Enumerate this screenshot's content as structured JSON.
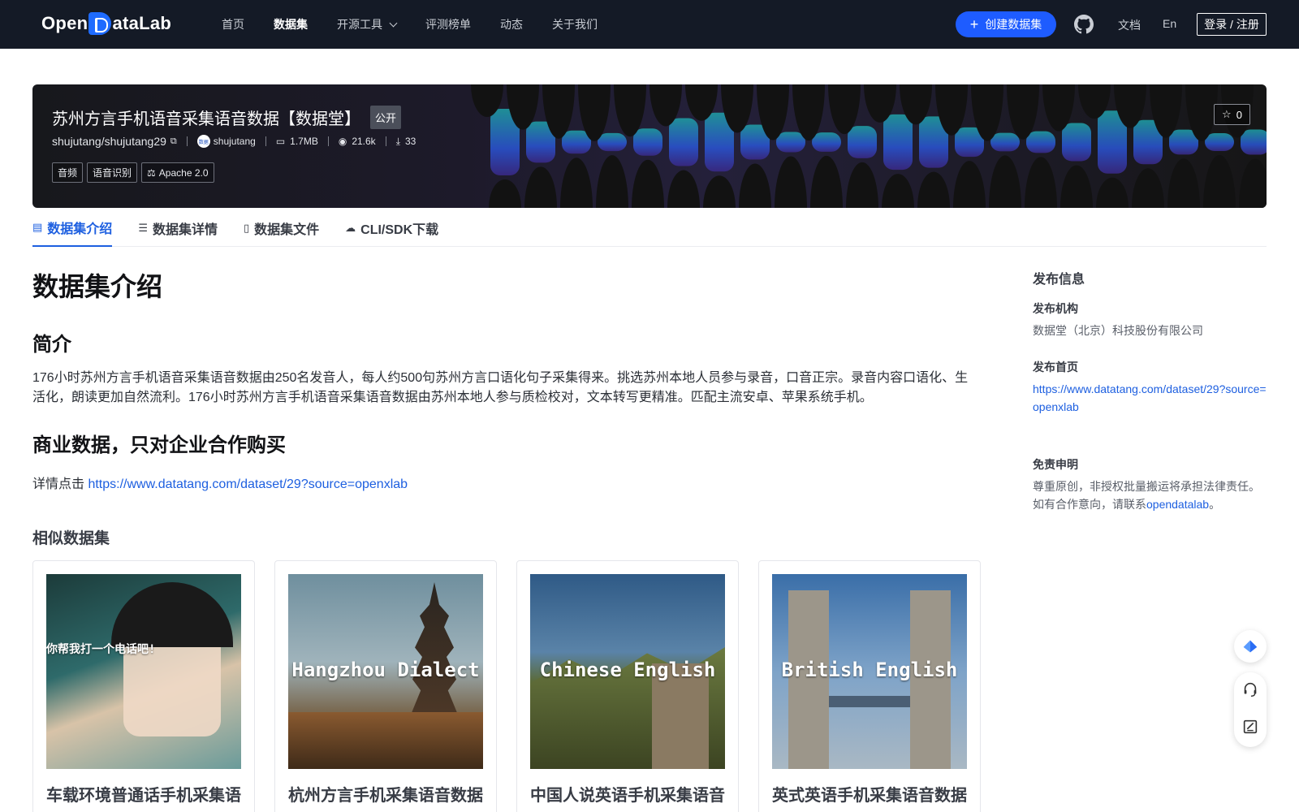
{
  "nav": {
    "logo_left": "Open",
    "logo_right": "ataLab",
    "items": [
      {
        "label": "首页"
      },
      {
        "label": "数据集"
      },
      {
        "label": "开源工具"
      },
      {
        "label": "评测榜单"
      },
      {
        "label": "动态"
      },
      {
        "label": "关于我们"
      }
    ],
    "create_label": "创建数据集",
    "docs_label": "文档",
    "lang_label": "En",
    "login_label": "登录 / 注册"
  },
  "dataset": {
    "title": "苏州方言手机语音采集语音数据【数据堂】",
    "visibility": "公开",
    "repo": "shujutang/shujutang29",
    "publisher": "shujutang",
    "size": "1.7MB",
    "views": "21.6k",
    "downloads": "33",
    "tags": [
      "音频",
      "语音识别",
      "Apache 2.0"
    ],
    "stars": "0"
  },
  "tabs": [
    {
      "label": "数据集介绍"
    },
    {
      "label": "数据集详情"
    },
    {
      "label": "数据集文件"
    },
    {
      "label": "CLI/SDK下载"
    }
  ],
  "content": {
    "h1": "数据集介绍",
    "intro_heading": "简介",
    "intro_text": "176小时苏州方言手机语音采集语音数据由250名发音人，每人约500句苏州方言口语化句子采集得来。挑选苏州本地人员参与录音，口音正宗。录音内容口语化、生活化，朗读更加自然流利。176小时苏州方言手机语音采集语音数据由苏州本地人参与质检校对，文本转写更精准。匹配主流安卓、苹果系统手机。",
    "commercial_heading": "商业数据，只对企业合作购买",
    "detail_prefix": "详情点击 ",
    "detail_link": "https://www.datatang.com/dataset/29?source=openxlab",
    "similar_title": "相似数据集",
    "cards": [
      {
        "thumb_text": "你帮我打一个电话吧!",
        "name": "车载环境普通话手机采集语音数据【数据堂】"
      },
      {
        "thumb_text": "Hangzhou Dialect",
        "name": "杭州方言手机采集语音数据【数据堂】"
      },
      {
        "thumb_text": "Chinese English",
        "name": "中国人说英语手机采集语音数据【数据堂】"
      },
      {
        "thumb_text": "British English",
        "name": "英式英语手机采集语音数据【数据堂】"
      }
    ]
  },
  "sidebar": {
    "title": "发布信息",
    "org_label": "发布机构",
    "org_value": "数据堂（北京）科技股份有限公司",
    "home_label": "发布首页",
    "home_value": "https://www.datatang.com/dataset/29?source=openxlab",
    "disclaimer_label": "免责申明",
    "disclaimer_text": "尊重原创，非授权批量搬运将承担法律责任。如有合作意向，请联系",
    "disclaimer_link": "opendatalab",
    "disclaimer_end": "。"
  }
}
